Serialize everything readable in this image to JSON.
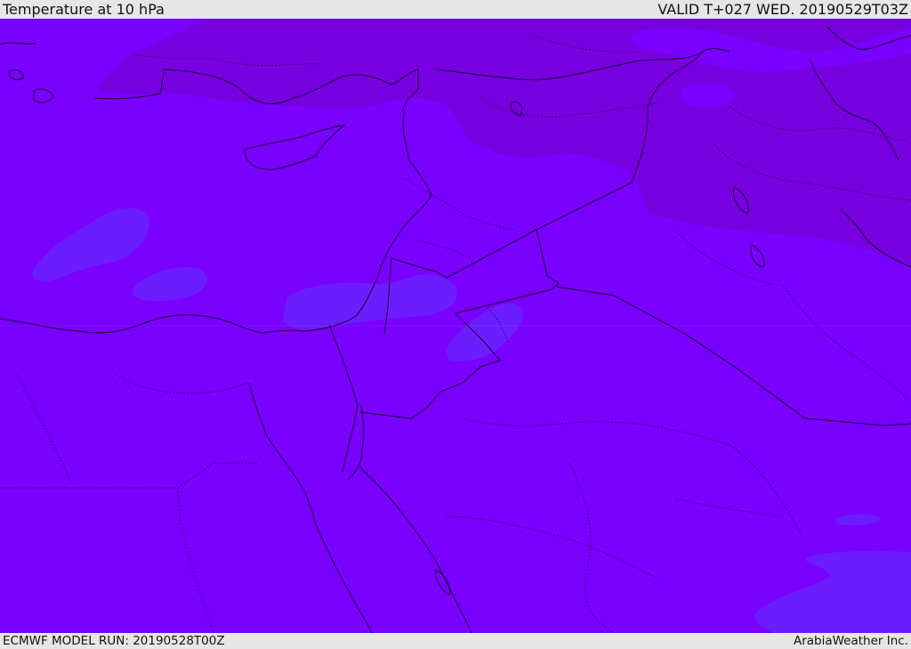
{
  "header": {
    "title": "Temperature at 10 hPa",
    "valid": "VALID T+027 WED. 20190529T03Z"
  },
  "footer": {
    "model_run": "ECMWF MODEL RUN: 20190528T00Z",
    "credit": "ArabiaWeather Inc."
  },
  "colors": {
    "base_field": "#7a00ff",
    "dark_field": "#7800e0",
    "light_field": "#6a22ff",
    "coastline": "#1a0030"
  }
}
